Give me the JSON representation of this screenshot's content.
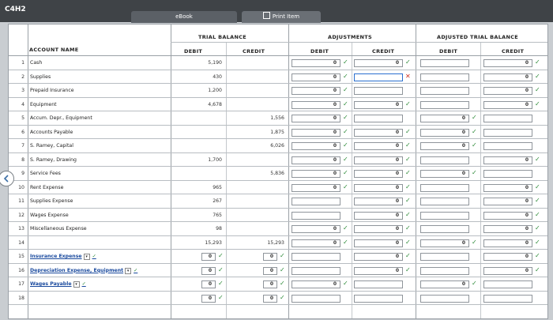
{
  "app": {
    "title": "C4H2",
    "tab_ebook": "eBook",
    "tab_print": "Print Item"
  },
  "headers": {
    "account_name": "ACCOUNT NAME",
    "trial_balance": "TRIAL BALANCE",
    "adjustments": "ADJUSTMENTS",
    "adjusted_trial_balance": "ADJUSTED TRIAL BALANCE",
    "debit": "DEBIT",
    "credit": "CREDIT"
  },
  "rows": [
    {
      "num": "1",
      "name": "Cash",
      "tb_debit": "5,190",
      "tb_credit": "",
      "adj_debit": {
        "v": "0",
        "m": "ok"
      },
      "adj_credit": {
        "v": "0",
        "m": "ok"
      },
      "atb_debit": {
        "v": "",
        "m": ""
      },
      "atb_credit": {
        "v": "0",
        "m": "ok"
      }
    },
    {
      "num": "2",
      "name": "Supplies",
      "tb_debit": "430",
      "tb_credit": "",
      "adj_debit": {
        "v": "0",
        "m": "ok"
      },
      "adj_credit": {
        "v": "",
        "m": "bad"
      },
      "atb_debit": {
        "v": "",
        "m": ""
      },
      "atb_credit": {
        "v": "0",
        "m": "ok"
      }
    },
    {
      "num": "3",
      "name": "Prepaid Insurance",
      "tb_debit": "1,200",
      "tb_credit": "",
      "adj_debit": {
        "v": "0",
        "m": "ok"
      },
      "adj_credit": {
        "v": "",
        "m": ""
      },
      "atb_debit": {
        "v": "",
        "m": ""
      },
      "atb_credit": {
        "v": "0",
        "m": "ok"
      }
    },
    {
      "num": "4",
      "name": "Equipment",
      "tb_debit": "4,678",
      "tb_credit": "",
      "adj_debit": {
        "v": "0",
        "m": "ok"
      },
      "adj_credit": {
        "v": "0",
        "m": "ok"
      },
      "atb_debit": {
        "v": "",
        "m": ""
      },
      "atb_credit": {
        "v": "0",
        "m": "ok"
      }
    },
    {
      "num": "5",
      "name": "Accum. Depr., Equipment",
      "tb_debit": "",
      "tb_credit": "1,556",
      "adj_debit": {
        "v": "0",
        "m": "ok"
      },
      "adj_credit": {
        "v": "",
        "m": ""
      },
      "atb_debit": {
        "v": "0",
        "m": "ok"
      },
      "atb_credit": {
        "v": "",
        "m": ""
      }
    },
    {
      "num": "6",
      "name": "Accounts Payable",
      "tb_debit": "",
      "tb_credit": "1,875",
      "adj_debit": {
        "v": "0",
        "m": "ok"
      },
      "adj_credit": {
        "v": "0",
        "m": "ok"
      },
      "atb_debit": {
        "v": "0",
        "m": "ok"
      },
      "atb_credit": {
        "v": "",
        "m": ""
      }
    },
    {
      "num": "7",
      "name": "S. Ramey, Capital",
      "tb_debit": "",
      "tb_credit": "6,026",
      "adj_debit": {
        "v": "0",
        "m": "ok"
      },
      "adj_credit": {
        "v": "0",
        "m": "ok"
      },
      "atb_debit": {
        "v": "0",
        "m": "ok"
      },
      "atb_credit": {
        "v": "",
        "m": ""
      }
    },
    {
      "num": "8",
      "name": "S. Ramey, Drawing",
      "tb_debit": "1,700",
      "tb_credit": "",
      "adj_debit": {
        "v": "0",
        "m": "ok"
      },
      "adj_credit": {
        "v": "0",
        "m": "ok"
      },
      "atb_debit": {
        "v": "",
        "m": ""
      },
      "atb_credit": {
        "v": "0",
        "m": "ok"
      }
    },
    {
      "num": "9",
      "name": "Service Fees",
      "tb_debit": "",
      "tb_credit": "5,836",
      "adj_debit": {
        "v": "0",
        "m": "ok"
      },
      "adj_credit": {
        "v": "0",
        "m": "ok"
      },
      "atb_debit": {
        "v": "0",
        "m": "ok"
      },
      "atb_credit": {
        "v": "",
        "m": ""
      }
    },
    {
      "num": "10",
      "name": "Rent Expense",
      "tb_debit": "965",
      "tb_credit": "",
      "adj_debit": {
        "v": "0",
        "m": "ok"
      },
      "adj_credit": {
        "v": "0",
        "m": "ok"
      },
      "atb_debit": {
        "v": "",
        "m": ""
      },
      "atb_credit": {
        "v": "0",
        "m": "ok"
      }
    },
    {
      "num": "11",
      "name": "Supplies Expense",
      "tb_debit": "267",
      "tb_credit": "",
      "adj_debit": {
        "v": "",
        "m": ""
      },
      "adj_credit": {
        "v": "0",
        "m": "ok"
      },
      "atb_debit": {
        "v": "",
        "m": ""
      },
      "atb_credit": {
        "v": "0",
        "m": "ok"
      }
    },
    {
      "num": "12",
      "name": "Wages Expense",
      "tb_debit": "765",
      "tb_credit": "",
      "adj_debit": {
        "v": "",
        "m": ""
      },
      "adj_credit": {
        "v": "0",
        "m": "ok"
      },
      "atb_debit": {
        "v": "",
        "m": ""
      },
      "atb_credit": {
        "v": "0",
        "m": "ok"
      }
    },
    {
      "num": "13",
      "name": "Miscellaneous Expense",
      "tb_debit": "98",
      "tb_credit": "",
      "adj_debit": {
        "v": "0",
        "m": "ok"
      },
      "adj_credit": {
        "v": "0",
        "m": "ok"
      },
      "atb_debit": {
        "v": "",
        "m": ""
      },
      "atb_credit": {
        "v": "0",
        "m": "ok"
      }
    },
    {
      "num": "14",
      "name": "",
      "tb_debit": "15,293",
      "tb_credit": "15,293",
      "adj_debit": {
        "v": "0",
        "m": "ok"
      },
      "adj_credit": {
        "v": "0",
        "m": "ok"
      },
      "atb_debit": {
        "v": "0",
        "m": "ok"
      },
      "atb_credit": {
        "v": "0",
        "m": "ok"
      }
    },
    {
      "num": "15",
      "name": "Insurance Expense",
      "select": true,
      "tb_debit_box": {
        "v": "0",
        "m": "ok"
      },
      "tb_credit_box": {
        "v": "0",
        "m": "ok"
      },
      "adj_debit": {
        "v": "",
        "m": ""
      },
      "adj_credit": {
        "v": "0",
        "m": "ok"
      },
      "atb_debit": {
        "v": "",
        "m": ""
      },
      "atb_credit": {
        "v": "0",
        "m": "ok"
      }
    },
    {
      "num": "16",
      "name": "Depreciation Expense, Equipment",
      "select": true,
      "tb_debit_box": {
        "v": "0",
        "m": "ok"
      },
      "tb_credit_box": {
        "v": "0",
        "m": "ok"
      },
      "adj_debit": {
        "v": "",
        "m": ""
      },
      "adj_credit": {
        "v": "0",
        "m": "ok"
      },
      "atb_debit": {
        "v": "",
        "m": ""
      },
      "atb_credit": {
        "v": "0",
        "m": "ok"
      }
    },
    {
      "num": "17",
      "name": "Wages Payable",
      "select": true,
      "tb_debit_box": {
        "v": "0",
        "m": "ok"
      },
      "tb_credit_box": {
        "v": "0",
        "m": "ok"
      },
      "adj_debit": {
        "v": "0",
        "m": "ok"
      },
      "adj_credit": {
        "v": "",
        "m": ""
      },
      "atb_debit": {
        "v": "0",
        "m": "ok"
      },
      "atb_credit": {
        "v": "",
        "m": ""
      }
    },
    {
      "num": "18",
      "name": "",
      "tb_debit_box": {
        "v": "0",
        "m": "ok"
      },
      "tb_credit_box": {
        "v": "0",
        "m": "ok"
      },
      "adj_debit": {
        "v": "",
        "m": ""
      },
      "adj_credit": {
        "v": "",
        "m": ""
      },
      "atb_debit": {
        "v": "",
        "m": ""
      },
      "atb_credit": {
        "v": "",
        "m": ""
      }
    }
  ],
  "colors": {
    "check": "#2e8b3a",
    "wrong": "#d03020",
    "active_border": "#2a6fcf"
  }
}
